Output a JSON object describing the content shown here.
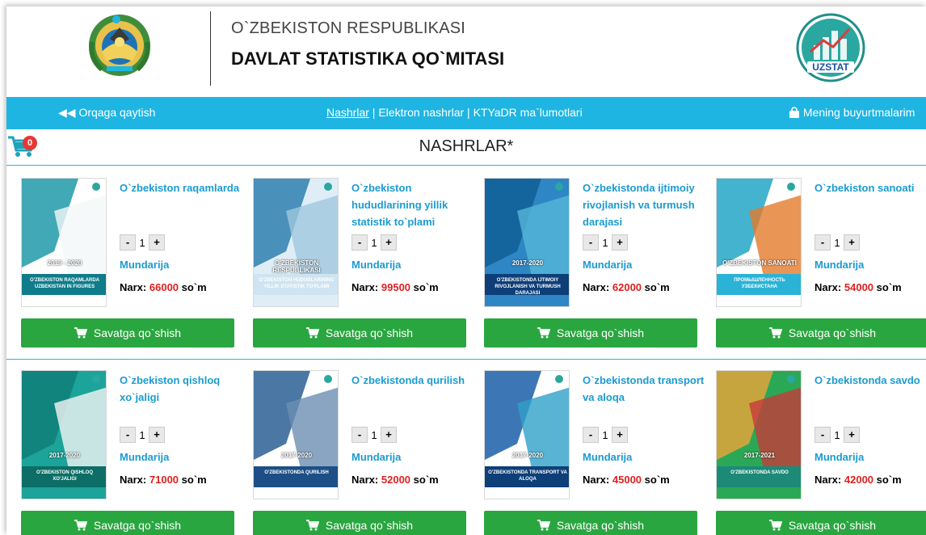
{
  "header": {
    "line1": "O`ZBEKISTON RESPUBLIKASI",
    "line2": "DAVLAT STATISTIKA QO`MITASI",
    "logo_text": "UZSTAT"
  },
  "nav": {
    "back_label": "Orqaga qaytish",
    "links": [
      "Nashrlar",
      "Elektron nashrlar",
      "KTYaDR ma`lumotlari"
    ],
    "separator": "|",
    "orders_label": "Mening buyurtmalarim"
  },
  "cart": {
    "count": "0"
  },
  "page_title": "NASHRLAR*",
  "labels": {
    "contents": "Mundarija",
    "price": "Narx:",
    "currency": "so`m",
    "add_to_cart": "Savatga qo`shish",
    "minus": "-",
    "plus": "+"
  },
  "products": [
    {
      "title": "O`zbekiston raqamlarda",
      "qty": "1",
      "price": "66000",
      "cover_theme": "teal",
      "cover_text": "2019 - 2020",
      "cover_text2": "O'ZBEKISTON RAQAMLARDA UZBEKISTAN IN FIGURES"
    },
    {
      "title": "O`zbekiston hududlarining yillik statistik to`plami",
      "qty": "1",
      "price": "99500",
      "cover_theme": "lightblue",
      "cover_text": "O'ZBEKISTON RESPUBLIKASI",
      "cover_text2": "O'ZBEKISTON HUDUDLARINING YILLIK STATISTIK TO'PLAMI"
    },
    {
      "title": "O`zbekistonda ijtimoiy rivojlanish va turmush darajasi",
      "qty": "1",
      "price": "62000",
      "cover_theme": "blue",
      "cover_text": "2017-2020",
      "cover_text2": "O'ZBEKISTONDA IJTIMOIY RIVOJLANISH VA TURMUSH DARAJASI"
    },
    {
      "title": "O`zbekiston sanoati",
      "qty": "1",
      "price": "54000",
      "cover_theme": "cyan",
      "cover_text": "O'ZBEKISTON SANOATI",
      "cover_text2": "ПРОМЫШЛЕННОСТЬ УЗБЕКИСТАНА"
    },
    {
      "title": "O`zbekiston qishloq xo`jaligi",
      "qty": "1",
      "price": "71000",
      "cover_theme": "green",
      "cover_text": "2017-2020",
      "cover_text2": "O'ZBEKISTON QISHLOQ XO'JALIGI"
    },
    {
      "title": "O`zbekistonda qurilish",
      "qty": "1",
      "price": "52000",
      "cover_theme": "building",
      "cover_text": "2017-2020",
      "cover_text2": "O'ZBEKISTONDA QURILISH"
    },
    {
      "title": "O`zbekistonda transport va aloqa",
      "qty": "1",
      "price": "45000",
      "cover_theme": "navy",
      "cover_text": "2017-2020",
      "cover_text2": "O'ZBEKISTONDA TRANSPORT VA ALOQA"
    },
    {
      "title": "O`zbekistonda savdo",
      "qty": "1",
      "price": "42000",
      "cover_theme": "market",
      "cover_text": "2017-2021",
      "cover_text2": "O'ZBEKISTONDA SAVDO"
    }
  ]
}
